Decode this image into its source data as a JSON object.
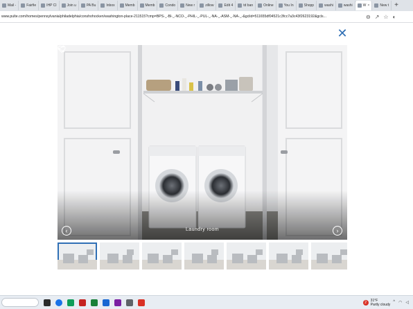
{
  "browser": {
    "tabs": [
      {
        "label": "Mail -"
      },
      {
        "label": "Fairfie"
      },
      {
        "label": "IHP Cl"
      },
      {
        "label": "Join u"
      },
      {
        "label": "PA Bu"
      },
      {
        "label": "Inbox"
      },
      {
        "label": "Memb"
      },
      {
        "label": "Memb"
      },
      {
        "label": "Condo"
      },
      {
        "label": "New r"
      },
      {
        "label": "zillow"
      },
      {
        "label": "Edit 4"
      },
      {
        "label": "td ban"
      },
      {
        "label": "Online"
      },
      {
        "label": "You In"
      },
      {
        "label": "Shopp"
      },
      {
        "label": "washi"
      },
      {
        "label": "washi"
      },
      {
        "label": "W"
      },
      {
        "label": "New t"
      }
    ],
    "active_tab_index": 18,
    "new_tab_label": "+",
    "url": "www.pulte.com/homes/pennsylvania/philadelphia/conshohocken/washington-place-211515?cmp=BPS-_-Bl-_-NCO-_-PHIL-_-PUL-_-NA-_-ASM-_-NA-_-&gclid=511655df04521c3fcc7a3c43f2623192&gcls..."
  },
  "viewer": {
    "close_label": "✕",
    "caption": "Laundry room",
    "prev_label": "‹",
    "next_label": "›",
    "thumbnails": [
      {
        "name": "thumb-laundry",
        "selected": true
      },
      {
        "name": "thumb-kitchen",
        "selected": false
      },
      {
        "name": "thumb-living",
        "selected": false
      },
      {
        "name": "thumb-living-2",
        "selected": false
      },
      {
        "name": "thumb-dining",
        "selected": false
      },
      {
        "name": "thumb-bedroom",
        "selected": false
      },
      {
        "name": "thumb-office",
        "selected": false
      }
    ]
  },
  "taskbar": {
    "weather_badge": "2",
    "temperature": "31°F",
    "condition": "Partly cloudy"
  },
  "colors": {
    "accent": "#2f6fb5",
    "photo_overlay": "#3a3d42"
  }
}
